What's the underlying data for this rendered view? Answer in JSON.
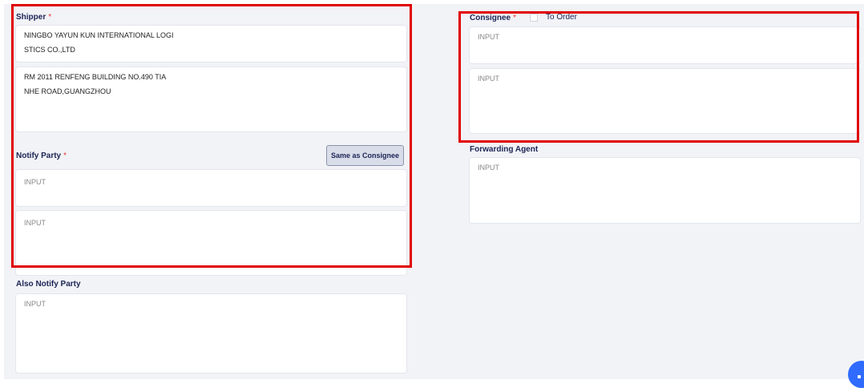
{
  "shipper": {
    "label": "Shipper",
    "required": "*",
    "name_line1": "NINGBO YAYUN KUN INTERNATIONAL LOGI",
    "name_line2": "STICS CO.,LTD",
    "addr_line1": "RM 2011 RENFENG BUILDING NO.490 TIA",
    "addr_line2": "NHE ROAD,GUANGZHOU"
  },
  "notify_party": {
    "label": "Notify Party",
    "required": "*",
    "same_button": "Same as Consignee",
    "name_placeholder": "INPUT",
    "addr_placeholder": "INPUT"
  },
  "also_notify": {
    "label": "Also Notify Party",
    "placeholder": "INPUT"
  },
  "consignee": {
    "label": "Consignee",
    "required": "*",
    "to_order": "To Order",
    "name_placeholder": "INPUT",
    "addr_placeholder": "INPUT"
  },
  "forwarding_agent": {
    "label": "Forwarding Agent",
    "placeholder": "INPUT"
  },
  "colors": {
    "label": "#1c2454",
    "required": "#e53935",
    "highlight": "#e00000",
    "fab": "#2f6bff"
  }
}
